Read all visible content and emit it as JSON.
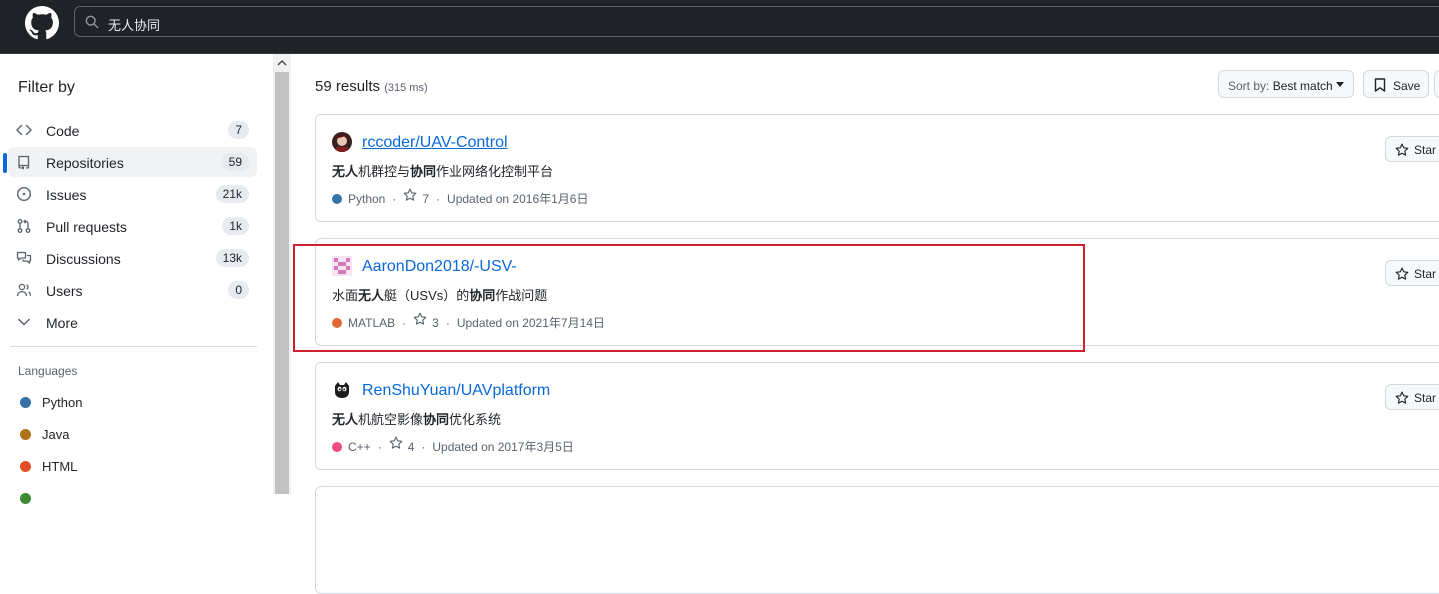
{
  "header": {
    "search_query": "无人协同"
  },
  "sidebar": {
    "title": "Filter by",
    "items": [
      {
        "label": "Code",
        "count": "7"
      },
      {
        "label": "Repositories",
        "count": "59"
      },
      {
        "label": "Issues",
        "count": "21k"
      },
      {
        "label": "Pull requests",
        "count": "1k"
      },
      {
        "label": "Discussions",
        "count": "13k"
      },
      {
        "label": "Users",
        "count": "0"
      },
      {
        "label": "More",
        "count": ""
      }
    ],
    "languages_title": "Languages",
    "languages": [
      {
        "label": "Python",
        "color": "#3572A5"
      },
      {
        "label": "Java",
        "color": "#b07219"
      },
      {
        "label": "HTML",
        "color": "#e34c26"
      }
    ]
  },
  "main": {
    "results_count": "59 results",
    "results_time": "(315 ms)",
    "sort_label": "Sort by:",
    "sort_value": "Best match",
    "save_label": "Save",
    "star_label": "Star",
    "repos": [
      {
        "name": "rccoder/UAV-Control",
        "desc_parts": [
          [
            "无人",
            true
          ],
          [
            "机群控与",
            false
          ],
          [
            "协同",
            true
          ],
          [
            "作业网络化控制平台",
            false
          ]
        ],
        "language": "Python",
        "lang_color": "#3572A5",
        "stars": "7",
        "updated": "Updated on 2016年1月6日"
      },
      {
        "name": "AaronDon2018/-USV-",
        "desc_parts": [
          [
            "水面",
            false
          ],
          [
            "无人",
            true
          ],
          [
            "艇（USVs）的",
            false
          ],
          [
            "协同",
            true
          ],
          [
            "作战问题",
            false
          ]
        ],
        "language": "MATLAB",
        "lang_color": "#e16737",
        "stars": "3",
        "updated": "Updated on 2021年7月14日"
      },
      {
        "name": "RenShuYuan/UAVplatform",
        "desc_parts": [
          [
            "无人",
            true
          ],
          [
            "机航空影像",
            false
          ],
          [
            "协同",
            true
          ],
          [
            "优化系统",
            false
          ]
        ],
        "language": "C++",
        "lang_color": "#f34b7d",
        "stars": "4",
        "updated": "Updated on 2017年3月5日"
      }
    ]
  }
}
